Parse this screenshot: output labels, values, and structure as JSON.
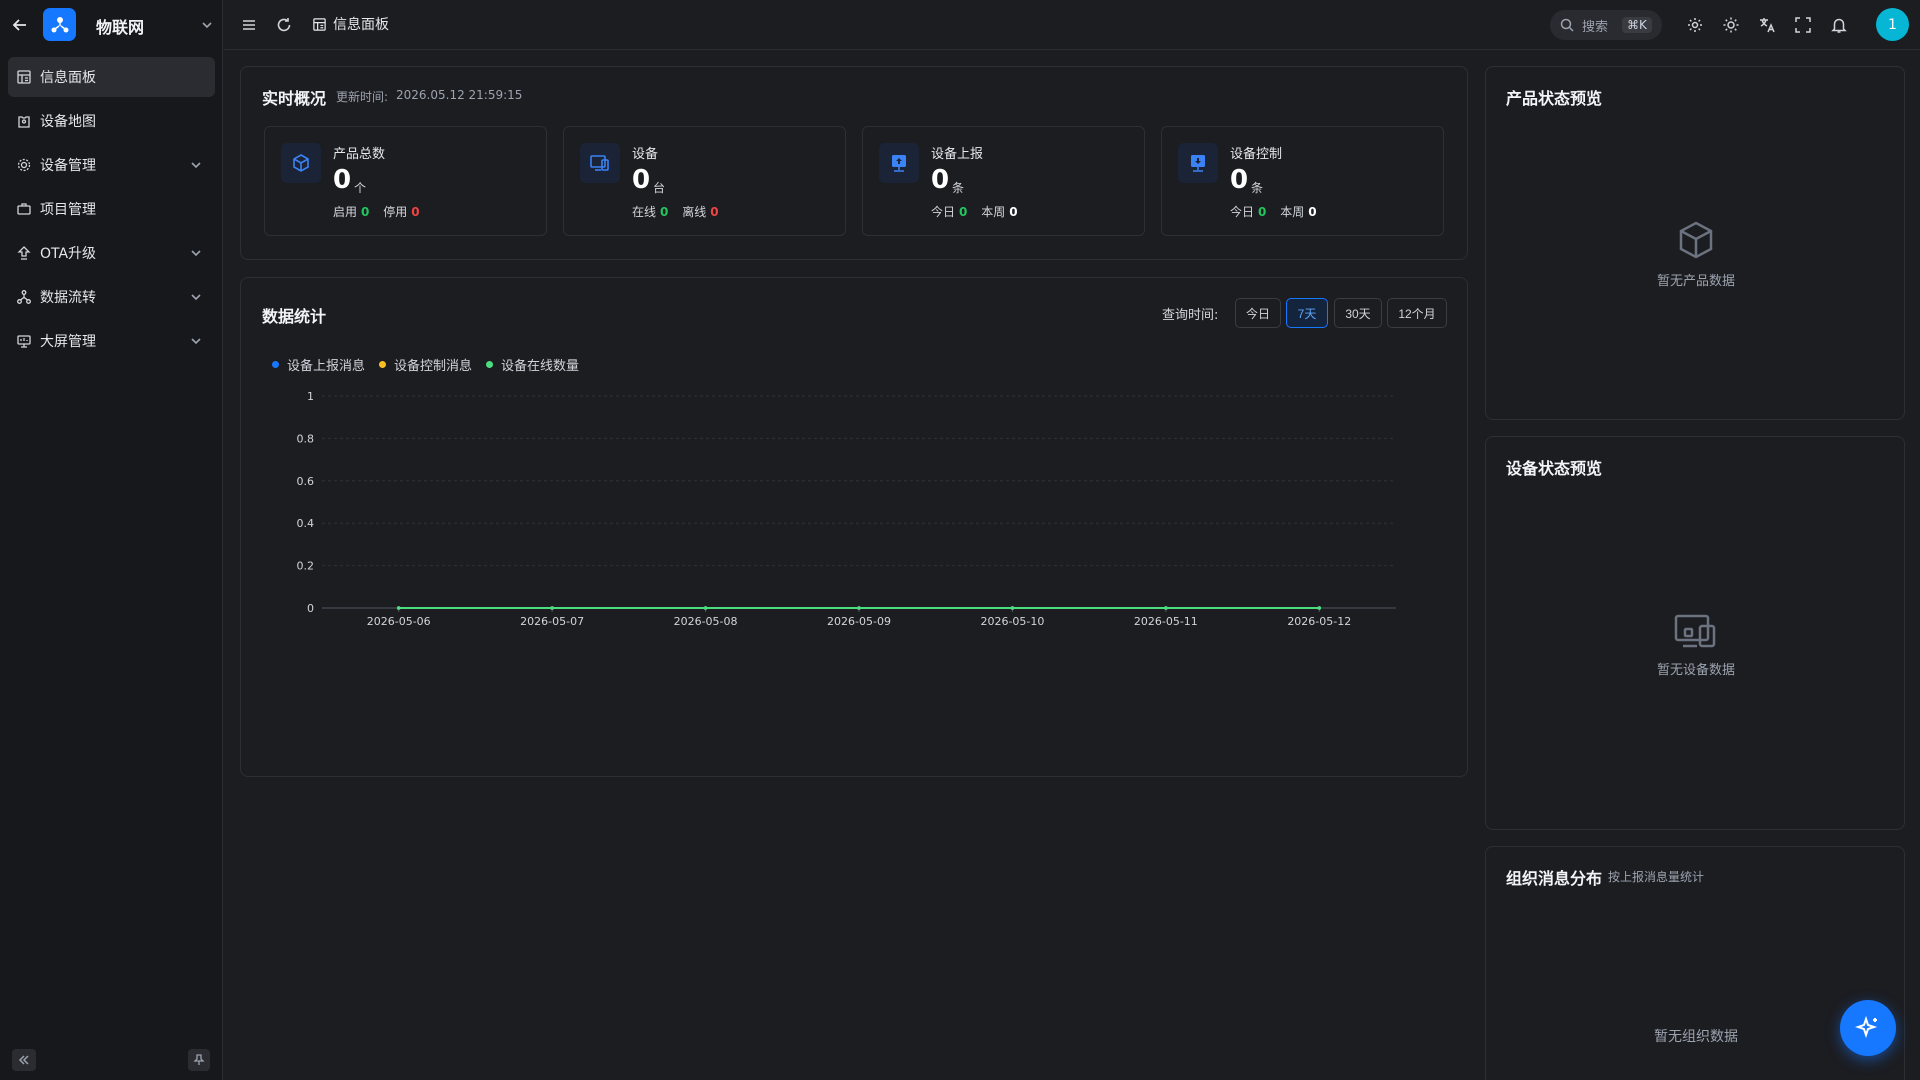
{
  "app": {
    "name": "物联网"
  },
  "sidebar": {
    "items": [
      {
        "label": "信息面板",
        "icon": "dashboard-icon",
        "active": true,
        "expandable": false
      },
      {
        "label": "设备地图",
        "icon": "map-icon",
        "active": false,
        "expandable": false
      },
      {
        "label": "设备管理",
        "icon": "device-gear-icon",
        "active": false,
        "expandable": true
      },
      {
        "label": "项目管理",
        "icon": "briefcase-icon",
        "active": false,
        "expandable": false
      },
      {
        "label": "OTA升级",
        "icon": "upgrade-icon",
        "active": false,
        "expandable": true
      },
      {
        "label": "数据流转",
        "icon": "flow-icon",
        "active": false,
        "expandable": true
      },
      {
        "label": "大屏管理",
        "icon": "screen-icon",
        "active": false,
        "expandable": true
      }
    ]
  },
  "header": {
    "breadcrumb": "信息面板",
    "search_label": "搜索",
    "search_shortcut": "⌘K",
    "avatar_text": "1"
  },
  "overview": {
    "title": "实时概况",
    "updated_label": "更新时间:",
    "updated_time": "2026.05.12 21:59:15",
    "stats": [
      {
        "label": "产品总数",
        "value": "0",
        "unit": "个",
        "sub1_label": "启用",
        "sub1_value": "0",
        "sub2_label": "停用",
        "sub2_value": "0",
        "icon": "cube-icon"
      },
      {
        "label": "设备",
        "value": "0",
        "unit": "台",
        "sub1_label": "在线",
        "sub1_value": "0",
        "sub2_label": "离线",
        "sub2_value": "0",
        "icon": "devices-icon"
      },
      {
        "label": "设备上报",
        "value": "0",
        "unit": "条",
        "sub1_label": "今日",
        "sub1_value": "0",
        "sub2_label": "本周",
        "sub2_value": "0",
        "icon": "upload-icon"
      },
      {
        "label": "设备控制",
        "value": "0",
        "unit": "条",
        "sub1_label": "今日",
        "sub1_value": "0",
        "sub2_label": "本周",
        "sub2_value": "0",
        "icon": "download-icon"
      }
    ]
  },
  "stats_panel": {
    "title": "数据统计",
    "range_label": "查询时间:",
    "ranges": [
      "今日",
      "7天",
      "30天",
      "12个月"
    ],
    "active_range": "7天"
  },
  "chart_data": {
    "type": "line",
    "x": [
      "2026-05-06",
      "2026-05-07",
      "2026-05-08",
      "2026-05-09",
      "2026-05-10",
      "2026-05-11",
      "2026-05-12"
    ],
    "series": [
      {
        "name": "设备上报消息",
        "color": "#1677ff",
        "values": [
          0,
          0,
          0,
          0,
          0,
          0,
          0
        ]
      },
      {
        "name": "设备控制消息",
        "color": "#fbbf24",
        "values": [
          0,
          0,
          0,
          0,
          0,
          0,
          0
        ]
      },
      {
        "name": "设备在线数量",
        "color": "#4ade80",
        "values": [
          0,
          0,
          0,
          0,
          0,
          0,
          0
        ]
      }
    ],
    "yticks": [
      "0",
      "0.2",
      "0.4",
      "0.6",
      "0.8",
      "1"
    ],
    "ylim": [
      0,
      1
    ],
    "grid": true,
    "legend": "top-left"
  },
  "product_status": {
    "title": "产品状态预览",
    "empty_text": "暂无产品数据"
  },
  "device_status": {
    "title": "设备状态预览",
    "empty_text": "暂无设备数据"
  },
  "org_messages": {
    "title": "组织消息分布",
    "subtitle": "按上报消息量统计",
    "empty_text": "暂无组织数据"
  }
}
